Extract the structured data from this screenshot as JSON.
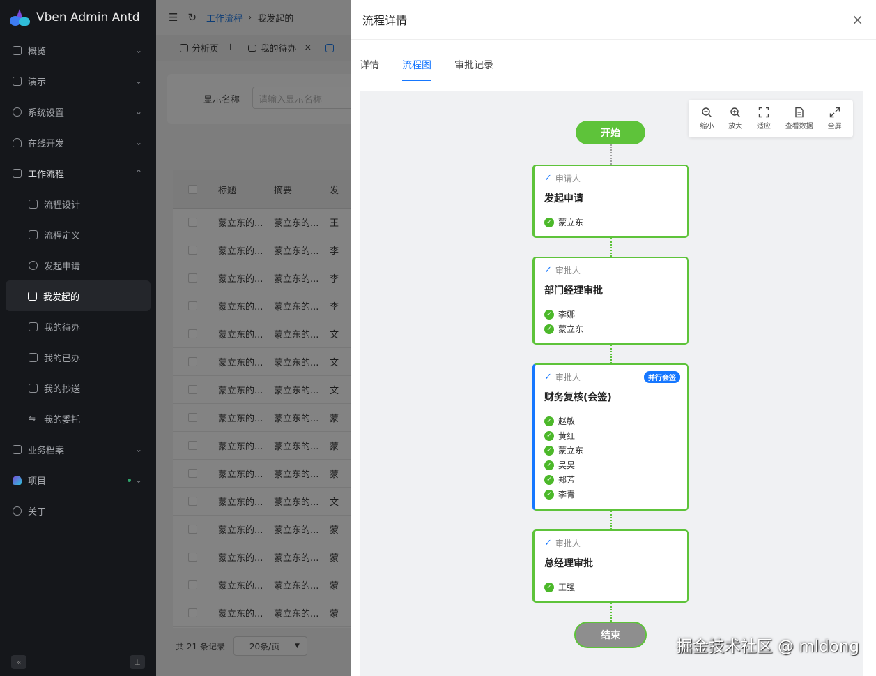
{
  "app": {
    "title": "Vben Admin Antd"
  },
  "sidebar": {
    "items": [
      {
        "label": "概览",
        "icon": "grid-icon"
      },
      {
        "label": "演示",
        "icon": "demo-icon"
      },
      {
        "label": "系统设置",
        "icon": "gear-icon"
      },
      {
        "label": "在线开发",
        "icon": "cloud-icon"
      },
      {
        "label": "工作流程",
        "icon": "flow-icon"
      }
    ],
    "workflow_sub": [
      {
        "label": "流程设计",
        "icon": "pen-icon"
      },
      {
        "label": "流程定义",
        "icon": "doc-icon"
      },
      {
        "label": "发起申请",
        "icon": "plus-circle-icon"
      },
      {
        "label": "我发起的",
        "icon": "edit-icon"
      },
      {
        "label": "我的待办",
        "icon": "mail-icon"
      },
      {
        "label": "我的已办",
        "icon": "book-icon"
      },
      {
        "label": "我的抄送",
        "icon": "copy-icon"
      },
      {
        "label": "我的委托",
        "icon": "swap-icon"
      }
    ],
    "bottom_items": [
      {
        "label": "业务档案",
        "icon": "file-icon"
      },
      {
        "label": "项目",
        "icon": "logo-icon"
      },
      {
        "label": "关于",
        "icon": "copyright-icon"
      }
    ]
  },
  "header": {
    "breadcrumb_1": "工作流程",
    "breadcrumb_2": "我发起的"
  },
  "tabs": [
    "分析页",
    "我的待办"
  ],
  "filter": {
    "label": "显示名称",
    "placeholder": "请输入显示名称"
  },
  "table": {
    "columns": [
      "标题",
      "摘要",
      "发"
    ],
    "rows": [
      [
        "蒙立东的...",
        "蒙立东的...",
        "王"
      ],
      [
        "蒙立东的...",
        "蒙立东的...",
        "李"
      ],
      [
        "蒙立东的...",
        "蒙立东的...",
        "李"
      ],
      [
        "蒙立东的...",
        "蒙立东的...",
        "李"
      ],
      [
        "蒙立东的...",
        "蒙立东的...",
        "文"
      ],
      [
        "蒙立东的...",
        "蒙立东的...",
        "文"
      ],
      [
        "蒙立东的...",
        "蒙立东的...",
        "文"
      ],
      [
        "蒙立东的...",
        "蒙立东的...",
        "蒙"
      ],
      [
        "蒙立东的...",
        "蒙立东的...",
        "蒙"
      ],
      [
        "蒙立东的...",
        "蒙立东的...",
        "蒙"
      ],
      [
        "蒙立东的...",
        "蒙立东的...",
        "文"
      ],
      [
        "蒙立东的...",
        "蒙立东的...",
        "蒙"
      ],
      [
        "蒙立东的...",
        "蒙立东的...",
        "蒙"
      ],
      [
        "蒙立东的...",
        "蒙立东的...",
        "蒙"
      ],
      [
        "蒙立东的...",
        "蒙立东的...",
        "蒙"
      ]
    ]
  },
  "pager": {
    "total": "共 21 条记录",
    "page_size": "20条/页"
  },
  "drawer": {
    "title": "流程详情",
    "tabs": [
      "详情",
      "流程图",
      "审批记录"
    ],
    "toolbar": [
      "缩小",
      "放大",
      "适应",
      "查看数据",
      "全屏"
    ],
    "start": "开始",
    "end": "结束",
    "nodes": [
      {
        "role": "申请人",
        "name": "发起申请",
        "people": [
          "蒙立东"
        ]
      },
      {
        "role": "审批人",
        "name": "部门经理审批",
        "people": [
          "李娜",
          "蒙立东"
        ]
      },
      {
        "role": "审批人",
        "name": "财务复核(会签)",
        "badge": "并行会签",
        "people": [
          "赵敏",
          "黄红",
          "蒙立东",
          "吴昊",
          "郑芳",
          "李青"
        ]
      },
      {
        "role": "审批人",
        "name": "总经理审批",
        "people": [
          "王强"
        ]
      }
    ]
  },
  "watermark": "掘金技术社区 @ mldong",
  "colors": {
    "accent": "#1677ff",
    "success": "#5ec33a"
  }
}
